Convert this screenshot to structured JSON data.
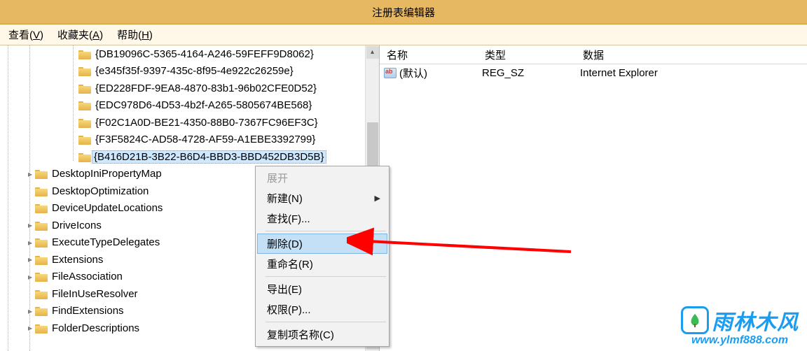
{
  "window": {
    "title": "注册表编辑器"
  },
  "menu": {
    "view": {
      "label": "查看",
      "hotkey": "V"
    },
    "favorites": {
      "label": "收藏夹",
      "hotkey": "A"
    },
    "help": {
      "label": "帮助",
      "hotkey": "H"
    }
  },
  "tree": {
    "guid_rows": [
      "{DB19096C-5365-4164-A246-59FEFF9D8062}",
      "{e345f35f-9397-435c-8f95-4e922c26259e}",
      "{ED228FDF-9EA8-4870-83b1-96b02CFE0D52}",
      "{EDC978D6-4D53-4b2f-A265-5805674BE568}",
      "{F02C1A0D-BE21-4350-88B0-7367FC96EF3C}",
      "{F3F5824C-AD58-4728-AF59-A1EBE3392799}",
      "{B416D21B-3B22-B6D4-BBD3-BBD452DB3D5B}"
    ],
    "other_rows": [
      "DesktopIniPropertyMap",
      "DesktopOptimization",
      "DeviceUpdateLocations",
      "DriveIcons",
      "ExecuteTypeDelegates",
      "Extensions",
      "FileAssociation",
      "FileInUseResolver",
      "FindExtensions",
      "FolderDescriptions"
    ]
  },
  "details": {
    "headers": {
      "name": "名称",
      "type": "类型",
      "data": "数据"
    },
    "row": {
      "name": "(默认)",
      "type": "REG_SZ",
      "data": "Internet Explorer"
    }
  },
  "context_menu": {
    "expand": "展开",
    "new": "新建(N)",
    "find": "查找(F)...",
    "delete": "删除(D)",
    "rename": "重命名(R)",
    "export": "导出(E)",
    "permissions": "权限(P)...",
    "copy_key_name": "复制项名称(C)"
  },
  "watermark": {
    "brand": "雨林木风",
    "url": "www.ylmf888.com"
  }
}
